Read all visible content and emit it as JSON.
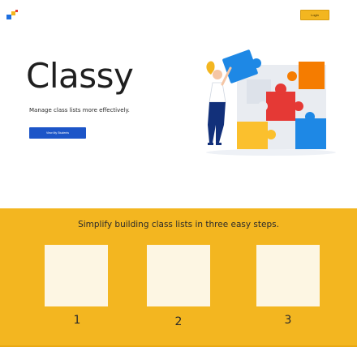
{
  "header": {
    "login_label": "Login"
  },
  "hero": {
    "title": "Classy",
    "subtitle": "Manage class lists more effectively.",
    "cta_label": "View My Students"
  },
  "steps": {
    "heading": "Simplify building class lists in three easy steps.",
    "items": [
      {
        "number": "1"
      },
      {
        "number": "2"
      },
      {
        "number": "3"
      }
    ]
  },
  "colors": {
    "accent_yellow": "#f3b620",
    "cta_blue": "#1c55c8",
    "card_cream": "#fdf6e3",
    "puzzle_red": "#e53935",
    "puzzle_orange": "#f57c00",
    "puzzle_blue": "#1e88e5",
    "puzzle_yellow": "#fbc02d"
  },
  "icons": {
    "logo": "puzzle-logo-icon",
    "illustration": "person-assembling-puzzle-illustration"
  }
}
